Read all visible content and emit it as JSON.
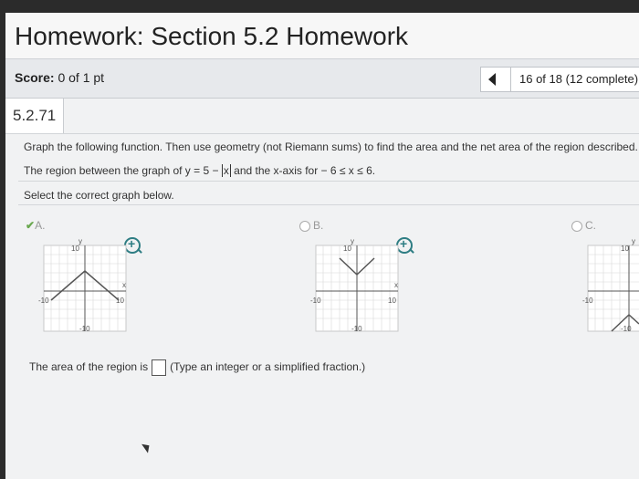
{
  "header": {
    "title": "Homework: Section 5.2 Homework"
  },
  "score": {
    "label": "Score:",
    "value": "0 of 1 pt"
  },
  "pager": {
    "text": "16 of 18 (12 complete)"
  },
  "question": {
    "number": "5.2.71",
    "instruction": "Graph the following function. Then use geometry (not Riemann sums) to find the area and the net area of the region described.",
    "region_prefix": "The region between the graph of y = 5 − ",
    "region_abs": "x",
    "region_suffix": " and the x-axis for  − 6 ≤ x ≤ 6.",
    "select": "Select the correct graph below."
  },
  "options": [
    {
      "label": "A.",
      "selected": true
    },
    {
      "label": "B.",
      "selected": false
    },
    {
      "label": "C.",
      "selected": false
    }
  ],
  "graph_labels": {
    "y": "y",
    "x": "x",
    "ten": "10",
    "neg_ten": "-10"
  },
  "answer": {
    "prefix": "The area of the region is",
    "hint": "(Type an integer or a simplified fraction.)"
  },
  "colors": {
    "accent": "#2e7d83",
    "check": "#6aa84f"
  }
}
